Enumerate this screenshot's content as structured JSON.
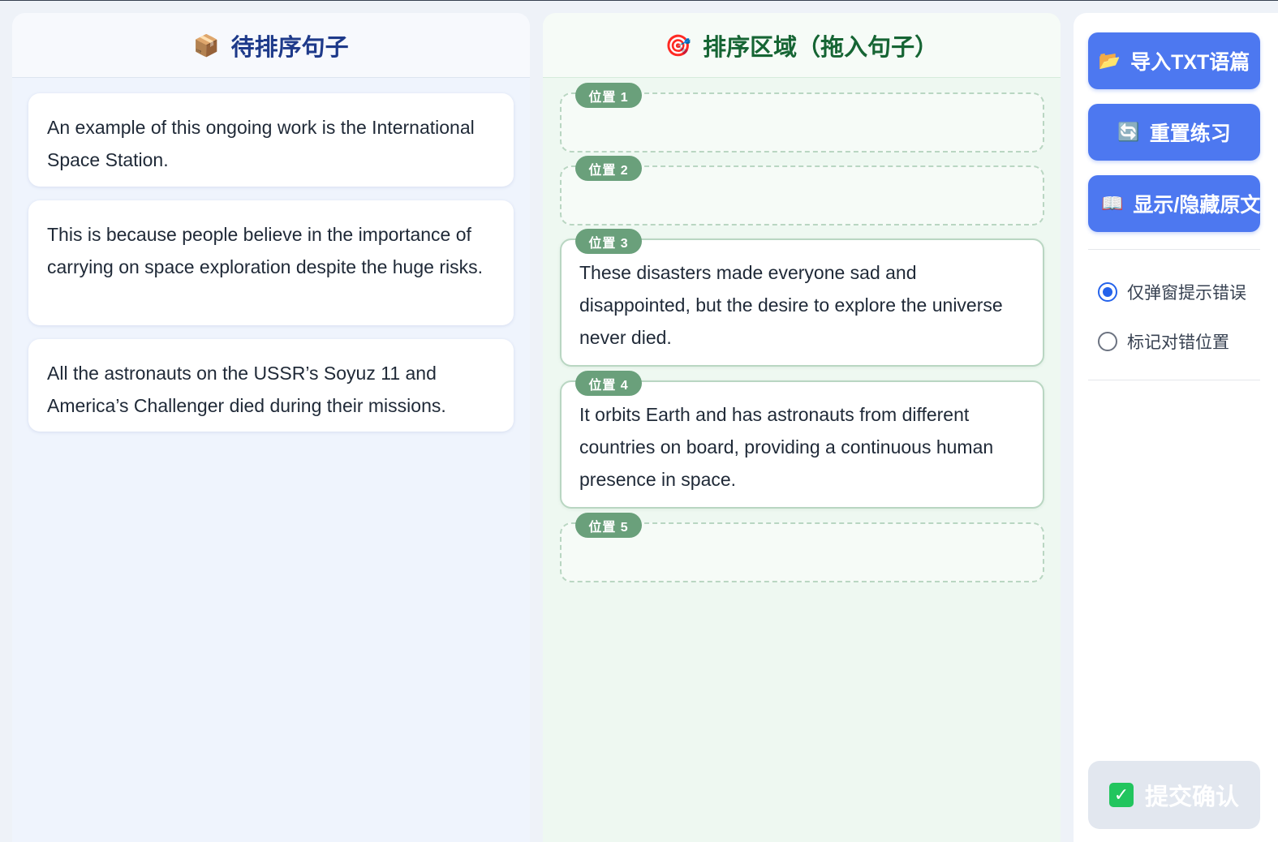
{
  "pending": {
    "title": "待排序句子",
    "icon": "package-icon",
    "sentences": [
      "An example of this ongoing work is the International Space Station.",
      "This is because people believe in the importance of carrying on space exploration despite the huge risks.",
      "All the astronauts on the USSR’s Soyuz 11 and America’s Challenger died during their missions."
    ]
  },
  "sorting": {
    "title": "排序区域（拖入句子）",
    "icon": "target-icon",
    "slots": [
      {
        "label": "位置 1",
        "text": ""
      },
      {
        "label": "位置 2",
        "text": ""
      },
      {
        "label": "位置 3",
        "text": "These disasters made everyone sad and disappointed, but the desire to explore the universe never died."
      },
      {
        "label": "位置 4",
        "text": "It orbits Earth and has astronauts from different countries on board, providing a continuous human presence in space."
      },
      {
        "label": "位置 5",
        "text": ""
      }
    ]
  },
  "side": {
    "import_label": "导入TXT语篇",
    "reset_label": "重置练习",
    "toggle_label": "显示/隐藏原文",
    "mode_popup_label": "仅弹窗提示错误",
    "mode_mark_label": "标记对错位置",
    "selected_mode": "popup",
    "submit_label": "提交确认"
  },
  "colors": {
    "primary_button": "#4d78f0",
    "slot_badge": "#6aa07b",
    "pending_title": "#1e3a8a",
    "sorting_title": "#166534"
  }
}
